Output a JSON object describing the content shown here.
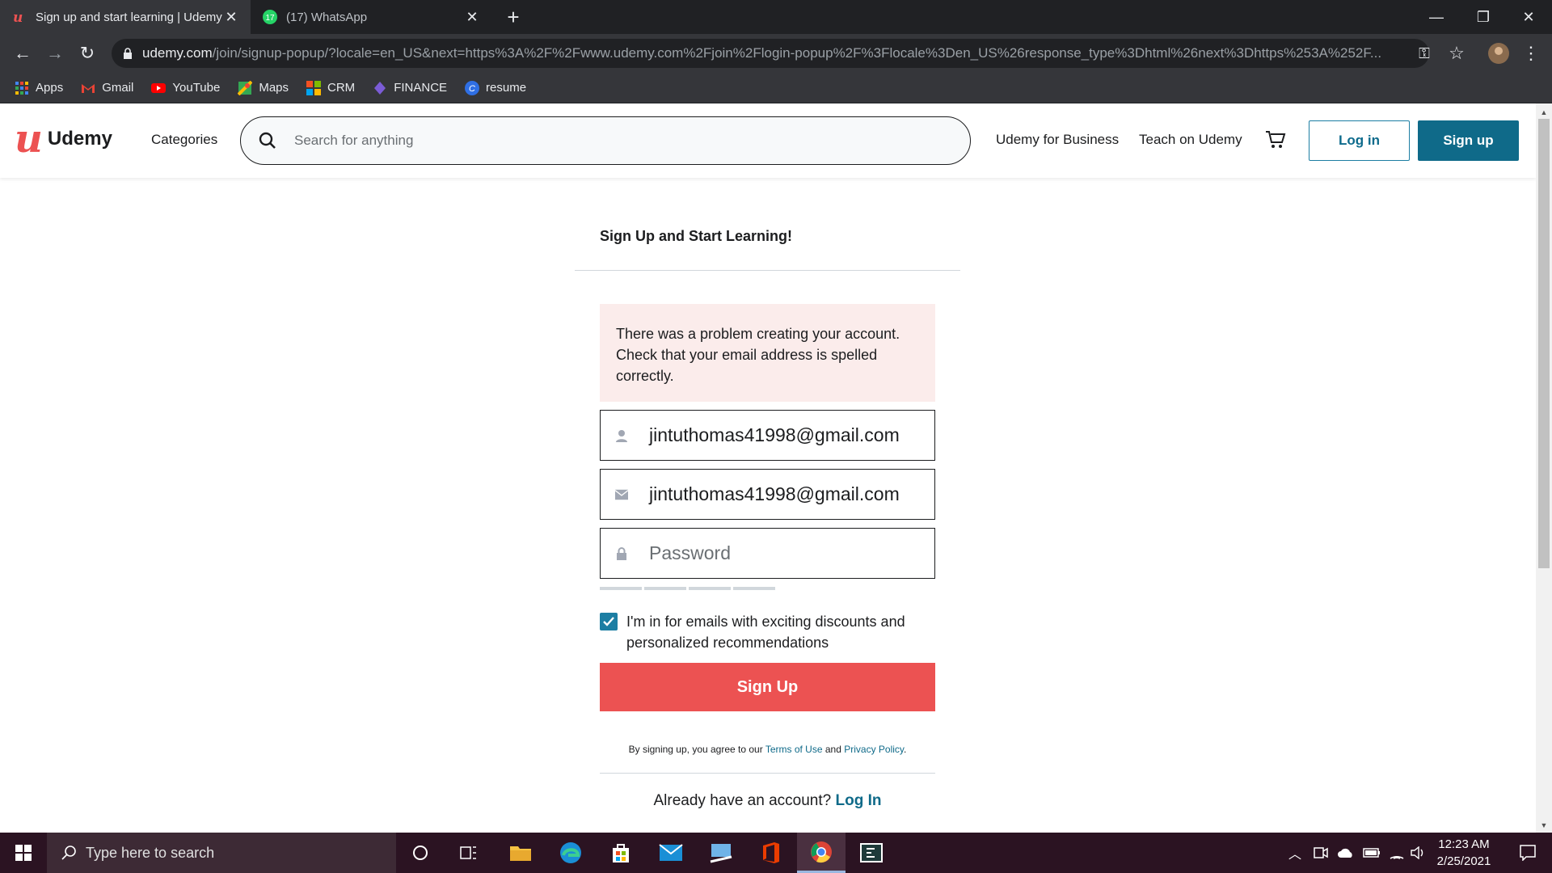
{
  "browser": {
    "tabs": [
      {
        "label": "Sign up and start learning | Udemy",
        "active": true,
        "icon": "udemy-favicon"
      },
      {
        "label": "(17) WhatsApp",
        "active": false,
        "icon": "whatsapp-favicon",
        "badge": "17"
      }
    ],
    "url_host": "udemy.com",
    "url_rest": "/join/signup-popup/?locale=en_US&next=https%3A%2F%2Fwww.udemy.com%2Fjoin%2Flogin-popup%2F%3Flocale%3Den_US%26response_type%3Dhtml%26next%3Dhttps%253A%252F...",
    "bookmarks": [
      {
        "label": "Apps",
        "icon": "apps-grid-icon"
      },
      {
        "label": "Gmail",
        "icon": "gmail-icon"
      },
      {
        "label": "YouTube",
        "icon": "youtube-icon"
      },
      {
        "label": "Maps",
        "icon": "maps-icon"
      },
      {
        "label": "CRM",
        "icon": "windows-tiles-icon"
      },
      {
        "label": "FINANCE",
        "icon": "finance-icon"
      },
      {
        "label": "resume",
        "icon": "resume-icon"
      }
    ]
  },
  "header": {
    "brand": "Udemy",
    "categories": "Categories",
    "search_placeholder": "Search for anything",
    "business": "Udemy for Business",
    "teach": "Teach on Udemy",
    "login": "Log in",
    "signup": "Sign up"
  },
  "form": {
    "title": "Sign Up and Start Learning!",
    "alert": "There was a problem creating your account. Check that your email address is spelled correctly.",
    "name_value": "jintuthomas41998@gmail.com",
    "email_value": "jintuthomas41998@gmail.com",
    "password_placeholder": "Password",
    "checkbox_label": "I'm in for emails with exciting discounts and personalized recommendations",
    "checkbox_checked": true,
    "submit": "Sign Up",
    "legal_prefix": "By signing up, you agree to our",
    "terms": "Terms of Use",
    "and": "and",
    "privacy": "Privacy Policy",
    "already": "Already have an account?",
    "login_link": "Log In"
  },
  "taskbar": {
    "search_placeholder": "Type here to search",
    "time": "12:23 AM",
    "date": "2/25/2021"
  },
  "colors": {
    "brand_red": "#ec5252",
    "link_blue": "#0f6a89",
    "alert_bg": "#fbeceb"
  }
}
